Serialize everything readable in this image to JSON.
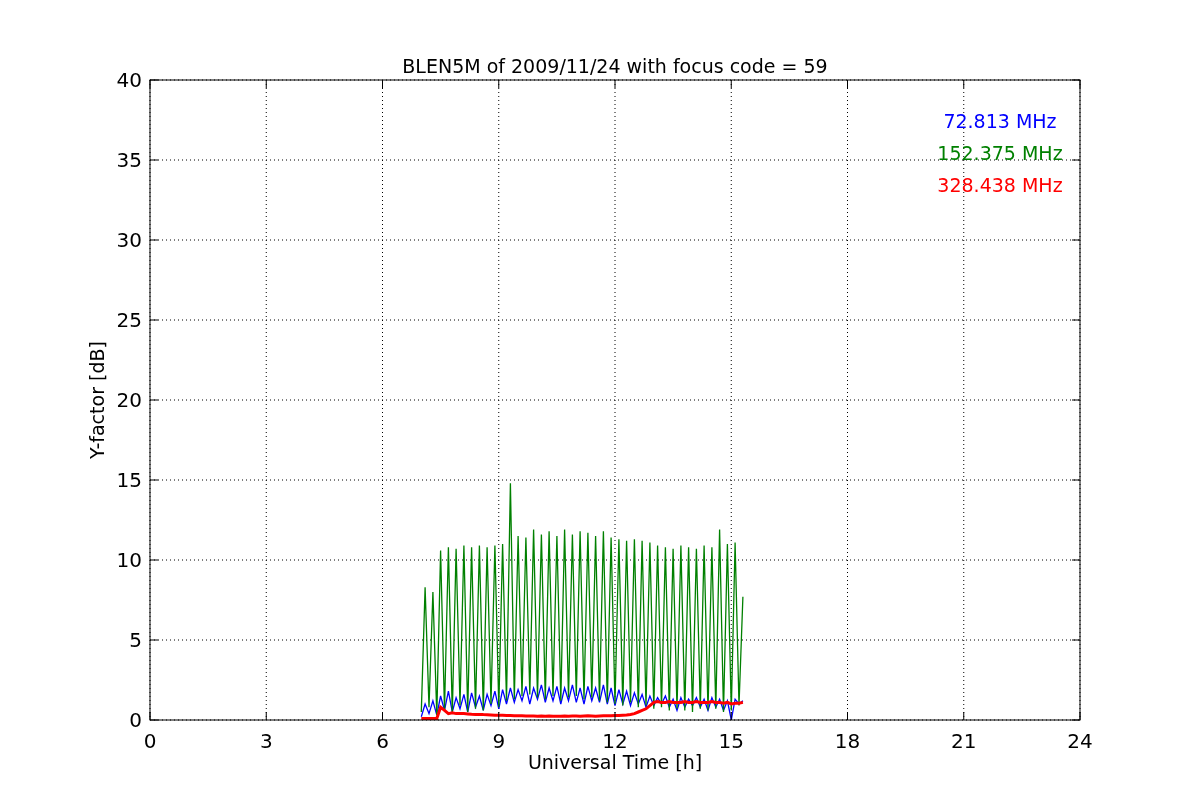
{
  "figure": {
    "chart_data": {
      "type": "line",
      "title": "BLEN5M of 2009/11/24 with focus code = 59",
      "xlabel": "Universal Time [h]",
      "ylabel": "Y-factor [dB]",
      "grid": true,
      "xlim": [
        0,
        24
      ],
      "ylim": [
        0,
        40
      ],
      "xticks": [
        0,
        3,
        6,
        9,
        12,
        15,
        18,
        21,
        24
      ],
      "yticks": [
        0,
        5,
        10,
        15,
        20,
        25,
        30,
        35,
        40
      ],
      "x": [
        7,
        7.1,
        7.2,
        7.3,
        7.4,
        7.5,
        7.6,
        7.7,
        7.8,
        7.9,
        8,
        8.1,
        8.2,
        8.3,
        8.4,
        8.5,
        8.6,
        8.7,
        8.8,
        8.9,
        9,
        9.1,
        9.2,
        9.3,
        9.4,
        9.5,
        9.6,
        9.7,
        9.8,
        9.9,
        10,
        10.1,
        10.2,
        10.3,
        10.4,
        10.5,
        10.6,
        10.7,
        10.8,
        10.9,
        11,
        11.1,
        11.2,
        11.3,
        11.4,
        11.5,
        11.6,
        11.7,
        11.8,
        11.9,
        12,
        12.1,
        12.2,
        12.3,
        12.4,
        12.5,
        12.6,
        12.7,
        12.8,
        12.9,
        13,
        13.1,
        13.2,
        13.3,
        13.4,
        13.5,
        13.6,
        13.7,
        13.8,
        13.9,
        14,
        14.1,
        14.2,
        14.3,
        14.4,
        14.5,
        14.6,
        14.7,
        14.8,
        14.9,
        15,
        15.1,
        15.2,
        15.3
      ],
      "series": [
        {
          "name": "72.813 MHz",
          "color": "#0000ff",
          "values": [
            0.2,
            1.0,
            0.4,
            1.2,
            0.3,
            1.5,
            0.6,
            1.8,
            0.5,
            1.4,
            0.7,
            1.6,
            0.5,
            1.7,
            0.8,
            1.5,
            0.6,
            1.6,
            0.9,
            1.8,
            0.7,
            1.9,
            1.0,
            2.0,
            1.1,
            1.9,
            1.2,
            2.1,
            1.0,
            2.0,
            1.3,
            2.2,
            1.1,
            2.0,
            1.2,
            2.1,
            1.0,
            2.0,
            1.2,
            2.2,
            1.1,
            2.0,
            1.0,
            2.1,
            1.2,
            2.0,
            1.1,
            2.2,
            1.0,
            2.0,
            0.9,
            1.9,
            1.0,
            1.8,
            0.9,
            1.7,
            1.0,
            1.6,
            0.8,
            1.5,
            0.9,
            1.4,
            1.0,
            1.5,
            0.8,
            1.3,
            0.6,
            1.4,
            0.8,
            1.3,
            0.9,
            1.4,
            0.8,
            1.3,
            0.6,
            1.4,
            0.8,
            1.3,
            0.6,
            1.2,
            0.0,
            1.3,
            1.0,
            1.2
          ]
        },
        {
          "name": "152.375 MHz",
          "color": "#008000",
          "values": [
            0.5,
            8.3,
            0.8,
            8.0,
            0.3,
            10.6,
            0.6,
            10.8,
            0.4,
            10.7,
            0.9,
            10.9,
            0.5,
            10.8,
            0.7,
            10.9,
            0.6,
            10.8,
            1.0,
            10.9,
            0.8,
            11.0,
            1.2,
            14.8,
            1.3,
            11.5,
            1.5,
            11.4,
            1.6,
            11.9,
            1.4,
            11.6,
            1.3,
            11.8,
            1.5,
            11.5,
            1.2,
            11.9,
            1.4,
            11.6,
            1.5,
            11.8,
            1.3,
            11.7,
            1.4,
            11.5,
            1.2,
            11.8,
            1.1,
            11.4,
            1.0,
            11.3,
            0.9,
            11.2,
            1.1,
            11.3,
            0.8,
            11.2,
            0.9,
            11.1,
            0.7,
            10.9,
            0.8,
            10.8,
            0.6,
            10.7,
            0.7,
            10.9,
            0.6,
            10.8,
            0.5,
            10.7,
            0.7,
            10.9,
            0.6,
            10.8,
            0.7,
            11.9,
            0.5,
            11.0,
            0.6,
            11.1,
            0.9,
            7.7
          ]
        },
        {
          "name": "328.438 MHz",
          "color": "#ff0000",
          "values": [
            0.1,
            0.1,
            0.1,
            0.1,
            0.1,
            0.8,
            0.6,
            0.4,
            0.45,
            0.4,
            0.4,
            0.4,
            0.38,
            0.36,
            0.35,
            0.35,
            0.34,
            0.33,
            0.32,
            0.3,
            0.3,
            0.3,
            0.28,
            0.28,
            0.27,
            0.27,
            0.26,
            0.25,
            0.25,
            0.25,
            0.24,
            0.25,
            0.24,
            0.25,
            0.24,
            0.23,
            0.24,
            0.25,
            0.24,
            0.25,
            0.25,
            0.24,
            0.25,
            0.26,
            0.25,
            0.24,
            0.25,
            0.26,
            0.27,
            0.27,
            0.28,
            0.28,
            0.3,
            0.32,
            0.35,
            0.4,
            0.5,
            0.6,
            0.7,
            0.9,
            1.1,
            1.15,
            1.1,
            1.1,
            1.15,
            1.1,
            1.1,
            1.1,
            1.15,
            1.1,
            1.1,
            1.15,
            1.1,
            1.1,
            1.1,
            1.15,
            1.1,
            1.1,
            1.05,
            1.1,
            1.0,
            1.05,
            1.05,
            1.1
          ]
        }
      ]
    }
  }
}
